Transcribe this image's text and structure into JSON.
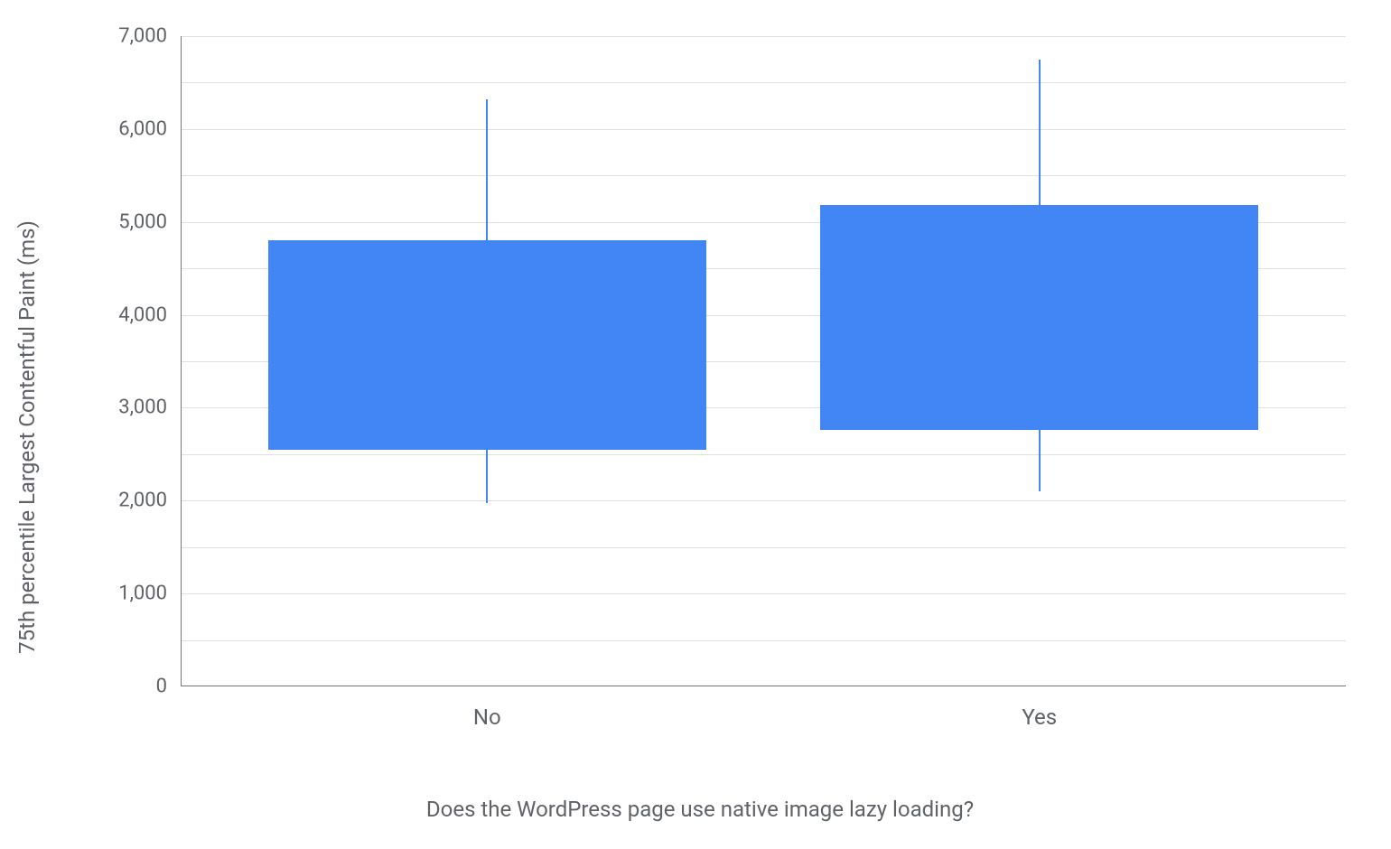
{
  "chart_data": {
    "type": "boxplot",
    "ylabel": "75th percentile Largest Contentful Paint (ms)",
    "xlabel": "Does the WordPress page use native image lazy loading?",
    "ylim": [
      0,
      7000
    ],
    "y_ticks": [
      0,
      1000,
      2000,
      3000,
      4000,
      5000,
      6000,
      7000
    ],
    "y_tick_labels": [
      "0",
      "1,000",
      "2,000",
      "3,000",
      "4,000",
      "5,000",
      "6,000",
      "7,000"
    ],
    "categories": [
      "No",
      "Yes"
    ],
    "series": [
      {
        "name": "No",
        "whisker_low": 1970,
        "q1": 2550,
        "q3": 4800,
        "whisker_high": 6320
      },
      {
        "name": "Yes",
        "whisker_low": 2100,
        "q1": 2760,
        "q3": 5180,
        "whisker_high": 6750
      }
    ],
    "color": "#4285f4"
  }
}
